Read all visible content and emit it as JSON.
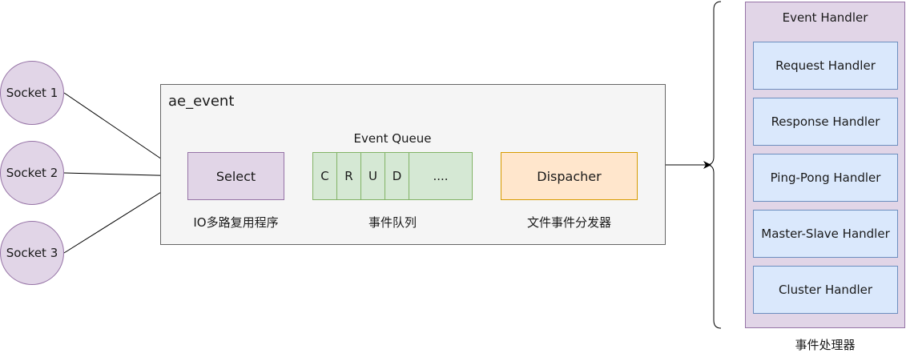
{
  "sockets": [
    {
      "label": "Socket 1"
    },
    {
      "label": "Socket 2"
    },
    {
      "label": "Socket 3"
    }
  ],
  "ae_event": {
    "title": "ae_event",
    "select": {
      "label": "Select",
      "caption": "IO多路复用程序"
    },
    "queue": {
      "title": "Event Queue",
      "cells": [
        "C",
        "R",
        "U",
        "D",
        "...."
      ],
      "caption": "事件队列"
    },
    "dispatcher": {
      "label": "Dispacher",
      "caption": "文件事件分发器"
    }
  },
  "event_handler": {
    "title": "Event Handler",
    "handlers": [
      "Request Handler",
      "Response Handler",
      "Ping-Pong Handler",
      "Master-Slave Handler",
      "Cluster Handler"
    ],
    "caption": "事件处理器"
  },
  "colors": {
    "purple_fill": "#e1d5e7",
    "green_fill": "#d5e8d4",
    "orange_fill": "#ffe6cc",
    "blue_fill": "#dae8fc",
    "container_fill": "#f5f5f5"
  }
}
